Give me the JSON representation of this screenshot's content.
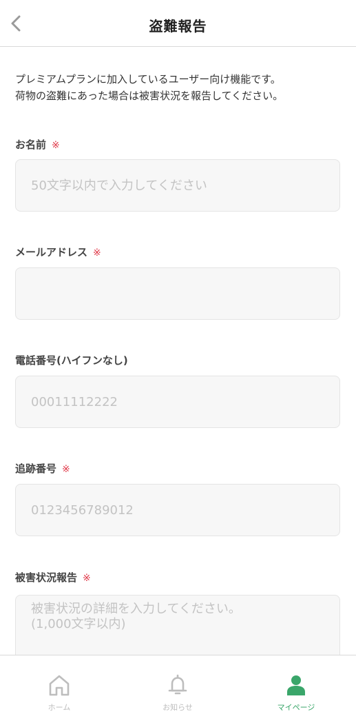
{
  "header": {
    "title": "盗難報告",
    "back_icon": "chevron-left-icon"
  },
  "intro": {
    "line1": "プレミアムプランに加入しているユーザー向け機能です。",
    "line2": "荷物の盗難にあった場合は被害状況を報告してください。"
  },
  "form": {
    "name": {
      "label": "お名前",
      "required_mark": "※",
      "placeholder": "50文字以内で入力してください",
      "value": ""
    },
    "email": {
      "label": "メールアドレス",
      "required_mark": "※",
      "placeholder": "",
      "value": ""
    },
    "phone": {
      "label": "電話番号(ハイフンなし)",
      "placeholder": "00011112222",
      "value": ""
    },
    "tracking": {
      "label": "追跡番号",
      "required_mark": "※",
      "placeholder": "0123456789012",
      "value": ""
    },
    "damage": {
      "label": "被害状況報告",
      "required_mark": "※",
      "placeholder": "被害状況の詳細を入力してください。\n(1,000文字以内)",
      "value": ""
    }
  },
  "tabbar": {
    "tabs": [
      {
        "label": "ホーム",
        "icon": "home-icon",
        "active": false
      },
      {
        "label": "お知らせ",
        "icon": "bell-icon",
        "active": false
      },
      {
        "label": "マイページ",
        "icon": "person-icon",
        "active": true
      }
    ]
  },
  "colors": {
    "required": "#e03a4a",
    "active_tab": "#3aa66a",
    "inactive_tab": "#bdbdbd",
    "input_bg": "#f7f7f7"
  }
}
